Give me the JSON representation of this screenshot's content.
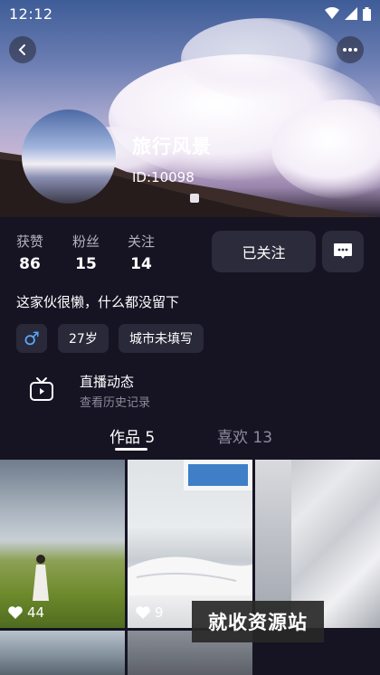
{
  "status_bar": {
    "time": "12:12"
  },
  "profile": {
    "name": "旅行风景",
    "id_text": "ID:10098"
  },
  "stats": [
    {
      "label": "获赞",
      "value": "86"
    },
    {
      "label": "粉丝",
      "value": "15"
    },
    {
      "label": "关注",
      "value": "14"
    }
  ],
  "actions": {
    "follow_label": "已关注"
  },
  "bio": "这家伙很懒，什么都没留下",
  "tags": {
    "gender_symbol": "♂",
    "age": "27岁",
    "city": "城市未填写"
  },
  "live": {
    "title": "直播动态",
    "subtitle": "查看历史记录"
  },
  "tabs": [
    {
      "label": "作品 5"
    },
    {
      "label": "喜欢 13"
    }
  ],
  "posts": [
    {
      "likes": "44"
    },
    {
      "likes": "9"
    }
  ],
  "watermark": "就收资源站",
  "colors": {
    "background": "#161423",
    "button": "#2c2b3b",
    "gender_accent": "#5aa8ff"
  }
}
